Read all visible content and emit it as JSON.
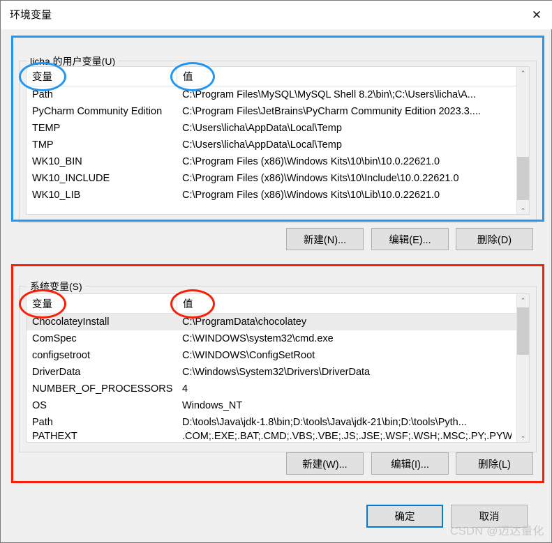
{
  "window": {
    "title": "环境变量",
    "close_label": "✕"
  },
  "user_section": {
    "legend": "licha 的用户变量(U)",
    "columns": {
      "variable": "变量",
      "value": "值"
    },
    "rows": [
      {
        "name": "Path",
        "value": "C:\\Program Files\\MySQL\\MySQL Shell 8.2\\bin\\;C:\\Users\\licha\\A..."
      },
      {
        "name": "PyCharm Community Edition",
        "value": "C:\\Program Files\\JetBrains\\PyCharm Community Edition 2023.3...."
      },
      {
        "name": "TEMP",
        "value": "C:\\Users\\licha\\AppData\\Local\\Temp"
      },
      {
        "name": "TMP",
        "value": "C:\\Users\\licha\\AppData\\Local\\Temp"
      },
      {
        "name": "WK10_BIN",
        "value": "C:\\Program Files (x86)\\Windows Kits\\10\\bin\\10.0.22621.0"
      },
      {
        "name": "WK10_INCLUDE",
        "value": "C:\\Program Files (x86)\\Windows Kits\\10\\Include\\10.0.22621.0"
      },
      {
        "name": "WK10_LIB",
        "value": "C:\\Program Files (x86)\\Windows Kits\\10\\Lib\\10.0.22621.0"
      }
    ],
    "buttons": {
      "new": "新建(N)...",
      "edit": "编辑(E)...",
      "delete": "删除(D)"
    }
  },
  "system_section": {
    "legend": "系统变量(S)",
    "columns": {
      "variable": "变量",
      "value": "值"
    },
    "rows": [
      {
        "name": "ChocolateyInstall",
        "value": "C:\\ProgramData\\chocolatey"
      },
      {
        "name": "ComSpec",
        "value": "C:\\WINDOWS\\system32\\cmd.exe"
      },
      {
        "name": "configsetroot",
        "value": "C:\\WINDOWS\\ConfigSetRoot"
      },
      {
        "name": "DriverData",
        "value": "C:\\Windows\\System32\\Drivers\\DriverData"
      },
      {
        "name": "NUMBER_OF_PROCESSORS",
        "value": "4"
      },
      {
        "name": "OS",
        "value": "Windows_NT"
      },
      {
        "name": "Path",
        "value": "D:\\tools\\Java\\jdk-1.8\\bin;D:\\tools\\Java\\jdk-21\\bin;D:\\tools\\Pyth..."
      },
      {
        "name": "PATHEXT",
        "value": ".COM;.EXE;.BAT;.CMD;.VBS;.VBE;.JS;.JSE;.WSF;.WSH;.MSC;.PY;.PYW"
      }
    ],
    "buttons": {
      "new": "新建(W)...",
      "edit": "编辑(I)...",
      "delete": "删除(L)"
    }
  },
  "footer": {
    "ok": "确定",
    "cancel": "取消"
  },
  "watermark": "CSDN @迈达量化",
  "scroll": {
    "up_glyph": "⌃",
    "down_glyph": "⌄"
  },
  "colors": {
    "annotation_blue": "#2196f3",
    "annotation_red": "#f81f06",
    "focus_blue": "#0078d7"
  }
}
